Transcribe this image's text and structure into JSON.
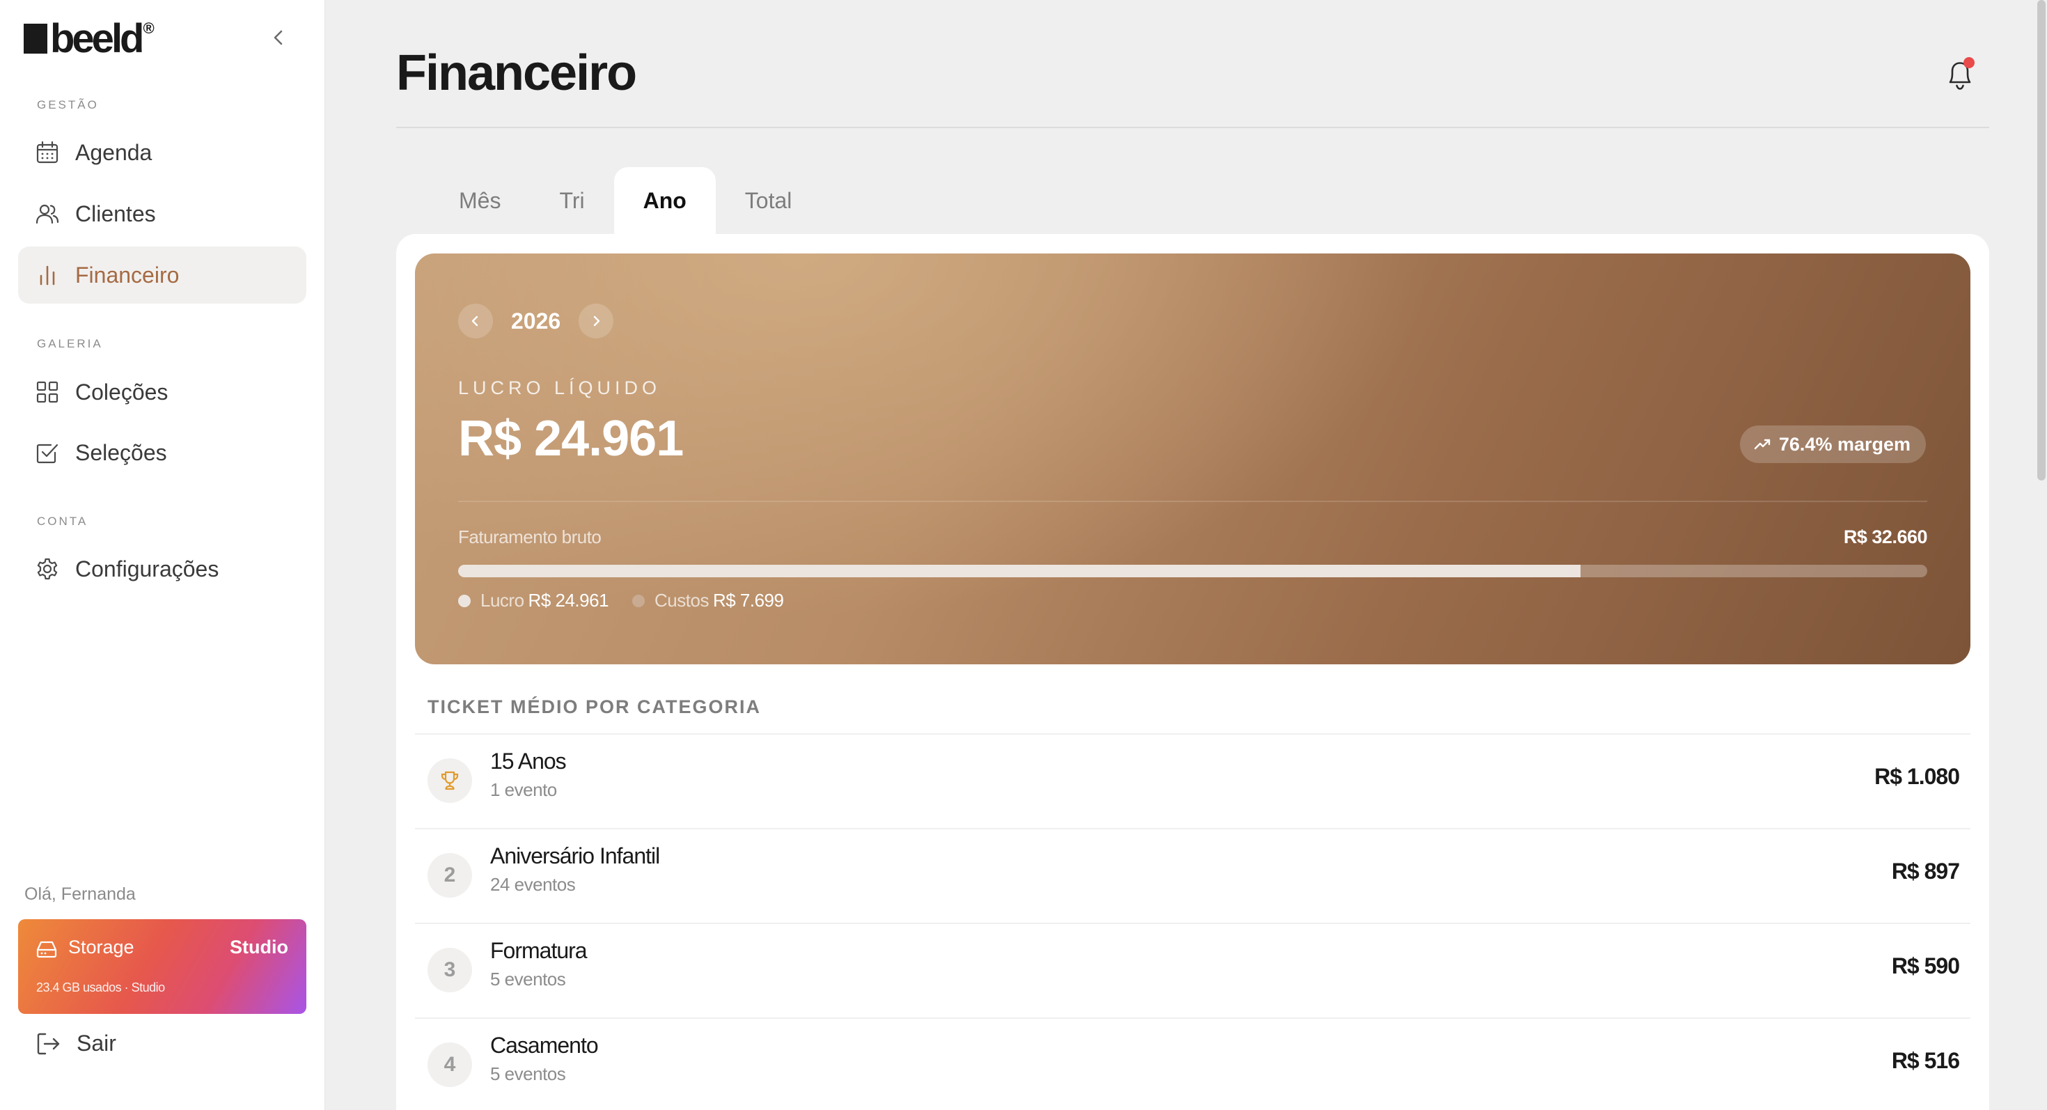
{
  "brand": {
    "name": "beeld",
    "reg": "®"
  },
  "sidebar": {
    "sections": [
      {
        "label": "GESTÃO"
      },
      {
        "label": "GALERIA"
      },
      {
        "label": "CONTA"
      }
    ],
    "items": [
      {
        "label": "Agenda",
        "icon": "calendar-icon"
      },
      {
        "label": "Clientes",
        "icon": "users-icon"
      },
      {
        "label": "Financeiro",
        "icon": "bar-chart-icon",
        "active": true
      },
      {
        "label": "Coleções",
        "icon": "grid-icon"
      },
      {
        "label": "Seleções",
        "icon": "checkbox-icon"
      },
      {
        "label": "Configurações",
        "icon": "gear-icon"
      }
    ],
    "greeting": "Olá, Fernanda",
    "storage": {
      "title": "Storage",
      "plan": "Studio",
      "usage": "23.4 GB usados · Studio"
    },
    "logout": "Sair"
  },
  "header": {
    "title": "Financeiro",
    "notification_badge": true
  },
  "tabs": [
    {
      "label": "Mês"
    },
    {
      "label": "Tri"
    },
    {
      "label": "Ano",
      "active": true
    },
    {
      "label": "Total"
    }
  ],
  "summary": {
    "year": "2026",
    "lucro_label": "LUCRO LÍQUIDO",
    "lucro_value": "R$ 24.961",
    "margin": "76.4% margem",
    "faturamento_label": "Faturamento bruto",
    "faturamento_value": "R$ 32.660",
    "lucro_fraction": 0.764,
    "legend": [
      {
        "label": "Lucro",
        "value": "R$ 24.961",
        "color": "#ece5df"
      },
      {
        "label": "Custos",
        "value": "R$ 7.699",
        "color": "#c9ab92"
      }
    ]
  },
  "categories": {
    "title": "TICKET MÉDIO POR CATEGORIA",
    "rows": [
      {
        "rank": "",
        "icon": "trophy-icon",
        "name": "15 Anos",
        "count": "1 evento",
        "value": "R$ 1.080"
      },
      {
        "rank": "2",
        "name": "Aniversário Infantil",
        "count": "24 eventos",
        "value": "R$ 897"
      },
      {
        "rank": "3",
        "name": "Formatura",
        "count": "5 eventos",
        "value": "R$ 590"
      },
      {
        "rank": "4",
        "name": "Casamento",
        "count": "5 eventos",
        "value": "R$ 516"
      }
    ]
  },
  "colors": {
    "accent": "#a66a43",
    "hero_start": "#c49d77",
    "hero_end": "#7d5438",
    "notification": "#e94a4a"
  }
}
